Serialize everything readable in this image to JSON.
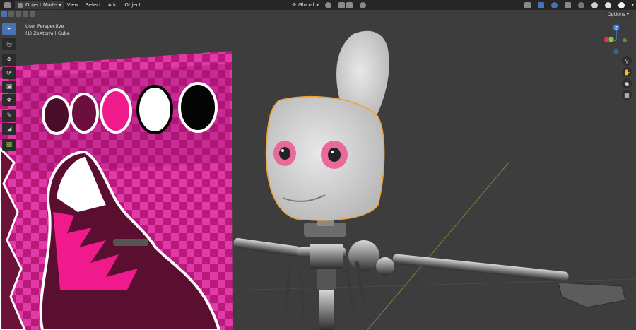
{
  "header": {
    "mode_label": "Object Mode",
    "menus": [
      "View",
      "Select",
      "Add",
      "Object"
    ],
    "transform_orientation": "Global",
    "options_label": "Options"
  },
  "viewport": {
    "perspective_label": "User Perspective",
    "object_label": "(1) ZeXtorm | Cube"
  },
  "gizmo": {
    "axis_z": "Z",
    "axis_x_color": "#e2344f",
    "axis_y_color": "#8bc53c",
    "axis_z_color": "#3c7bd8"
  },
  "colors": {
    "header_bg": "#262626",
    "viewport_bg": "#3d3d3d",
    "accent": "#4772b3",
    "selection_outline": "#f0a030"
  }
}
